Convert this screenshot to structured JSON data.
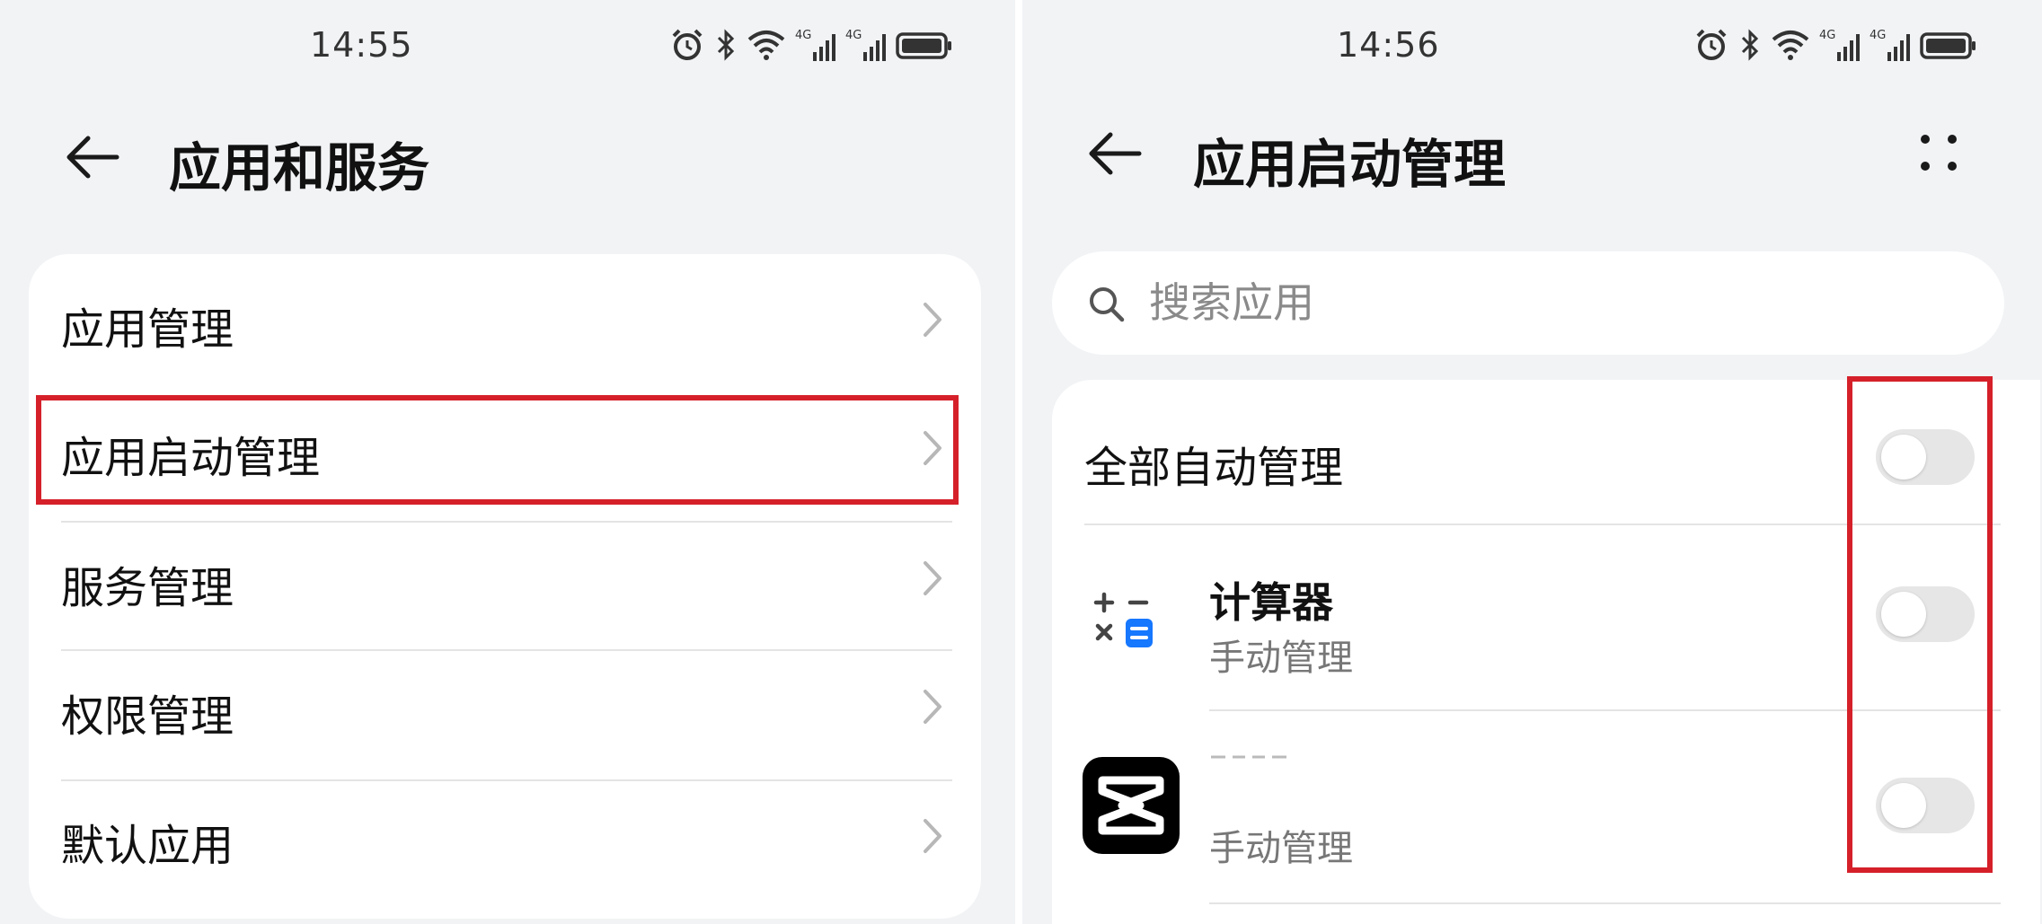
{
  "left": {
    "status": {
      "time": "14:55"
    },
    "header": {
      "title": "应用和服务"
    },
    "menu": [
      {
        "label": "应用管理"
      },
      {
        "label": "应用启动管理"
      },
      {
        "label": "服务管理"
      },
      {
        "label": "权限管理"
      },
      {
        "label": "默认应用"
      }
    ]
  },
  "right": {
    "status": {
      "time": "14:56"
    },
    "header": {
      "title": "应用启动管理"
    },
    "search": {
      "placeholder": "搜索应用",
      "value": ""
    },
    "master": {
      "label": "全部自动管理",
      "enabled": false
    },
    "apps": [
      {
        "name": "计算器",
        "mode": "手动管理",
        "enabled": false,
        "icon": "calculator-icon"
      },
      {
        "name": "",
        "mode": "手动管理",
        "enabled": false,
        "icon": "capcut-icon"
      }
    ]
  },
  "colors": {
    "background": "#f1f3f5",
    "card": "#ffffff",
    "highlight": "#d5202a",
    "switch_off": "#e6e6e6",
    "calculator_blue": "#1677ff"
  },
  "icons": [
    "alarm-icon",
    "bluetooth-icon",
    "wifi-icon",
    "signal-4g-icon",
    "battery-icon",
    "back-arrow-icon",
    "chevron-right-icon",
    "more-icon",
    "search-icon"
  ]
}
